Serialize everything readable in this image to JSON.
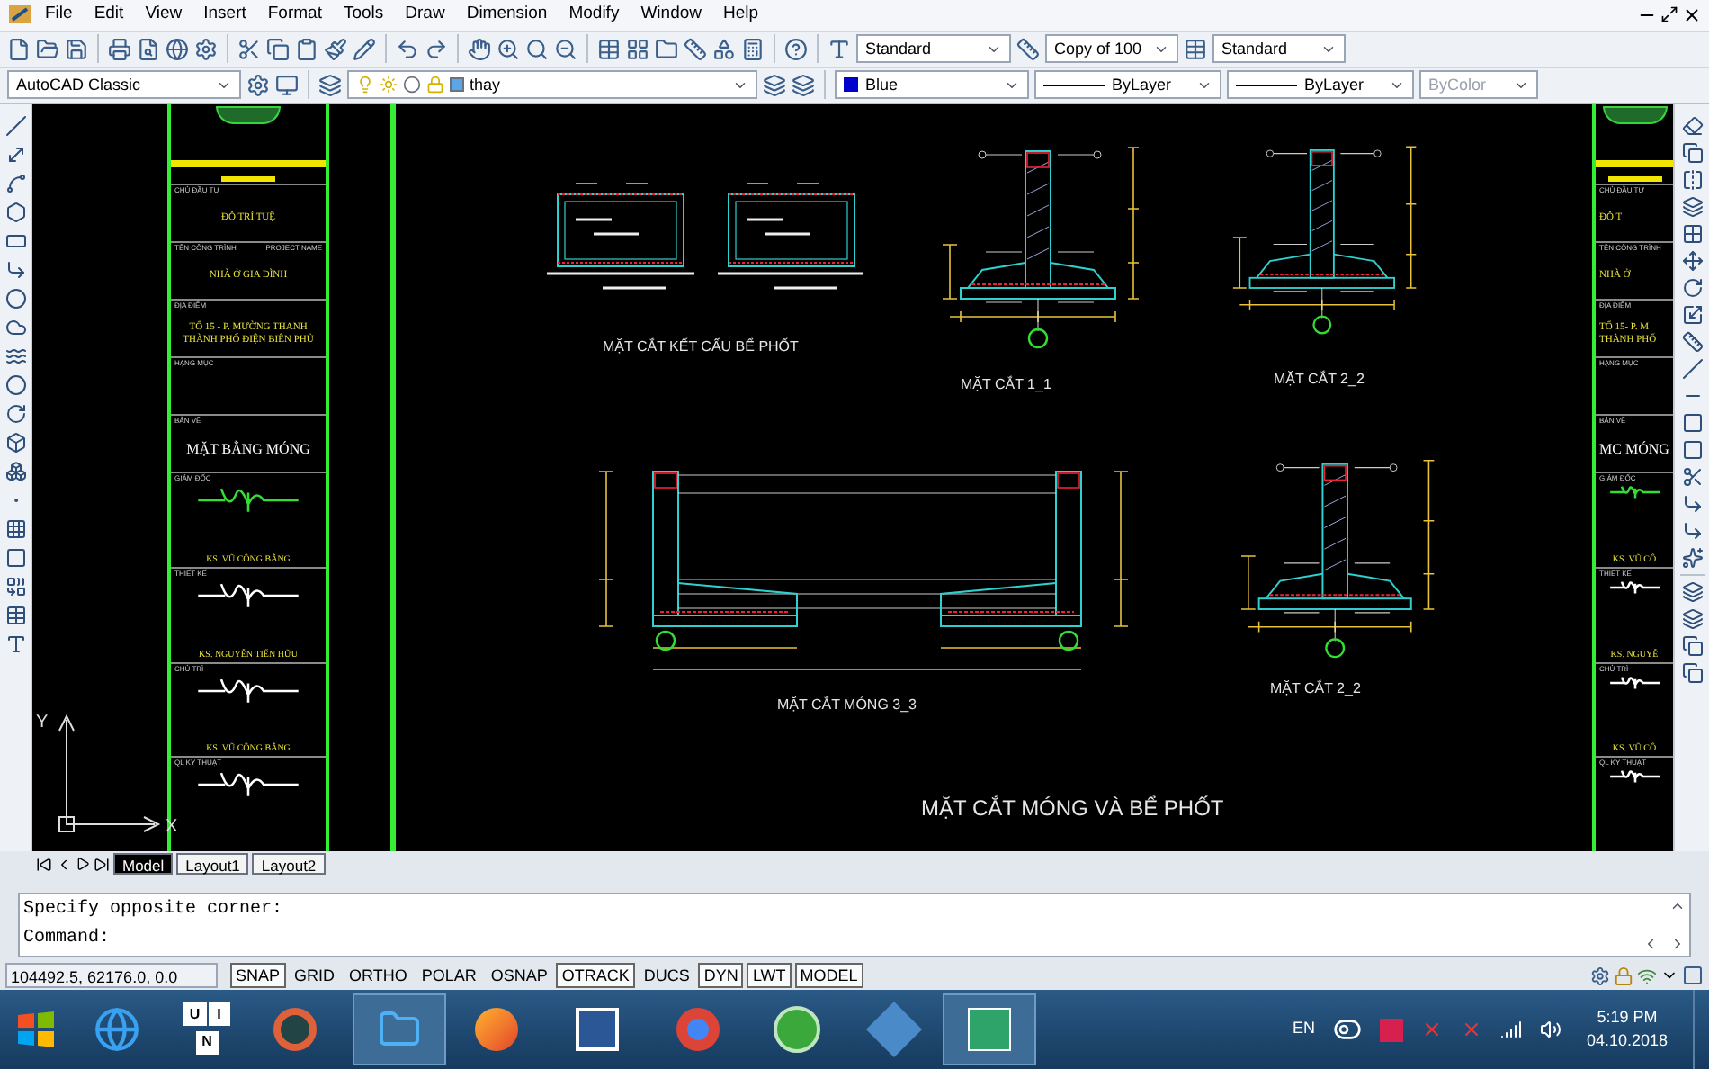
{
  "menu_bar": {
    "items": [
      "File",
      "Edit",
      "View",
      "Insert",
      "Format",
      "Tools",
      "Draw",
      "Dimension",
      "Modify",
      "Window",
      "Help"
    ]
  },
  "styles_toolbar": {
    "text_style": "Standard",
    "dim_style": "Copy of 100",
    "table_style": "Standard"
  },
  "workspace": "AutoCAD Classic",
  "layer": "thay",
  "properties_toolbar": {
    "color_setting": "Blue",
    "linetype": "ByLayer",
    "lineweight": "ByLayer",
    "plot_style": {
      "value": "ByColor",
      "disabled": true
    }
  },
  "title_block_left": {
    "rows": [
      {
        "kind": "text",
        "label": "CHỦ ĐẦU TƯ",
        "lines": [
          "ĐỖ TRÍ TUỆ"
        ]
      },
      {
        "kind": "text",
        "label": "TÊN CÔNG TRÌNH",
        "label_right": "PROJECT NAME",
        "lines": [
          "NHÀ Ở GIA ĐÌNH"
        ]
      },
      {
        "kind": "text",
        "label": "ĐỊA ĐIỂM",
        "lines": [
          "TỔ 15 - P. MƯỜNG THANH",
          "THÀNH PHỐ ĐIỆN BIÊN PHỦ"
        ]
      },
      {
        "kind": "text",
        "label": "HẠNG MỤC",
        "lines": []
      },
      {
        "kind": "title",
        "label": "BẢN VẼ",
        "lines": [
          "MẶT BẰNG MÓNG"
        ]
      },
      {
        "kind": "signature",
        "label": "GIÁM ĐỐC",
        "signer": "KS. VŨ CÔNG BẰNG",
        "color": "#33dd33"
      },
      {
        "kind": "signature",
        "label": "THIẾT KẾ",
        "signer": "KS. NGUYỄN TIẾN HỮU",
        "color": "#ffffff"
      },
      {
        "kind": "signature",
        "label": "CHỦ TRÌ",
        "signer": "KS. VŨ CÔNG BẰNG",
        "color": "#ffffff"
      },
      {
        "kind": "signature",
        "label": "QL KỸ THUẬT",
        "color": "#ffffff"
      }
    ]
  },
  "title_block_right": {
    "rows": [
      {
        "kind": "text",
        "label": "CHỦ ĐẦU TƯ",
        "lines": [
          "ĐỖ T"
        ]
      },
      {
        "kind": "text",
        "label": "TÊN CÔNG TRÌNH",
        "lines": [
          "NHÀ Ở"
        ]
      },
      {
        "kind": "text",
        "label": "ĐỊA ĐIỂM",
        "lines": [
          "TỔ 15- P. M",
          "THÀNH PHỐ"
        ]
      },
      {
        "kind": "text",
        "label": "HẠNG MỤC",
        "lines": []
      },
      {
        "kind": "title",
        "label": "BẢN VẼ",
        "lines": [
          "MC MÓNG"
        ]
      },
      {
        "kind": "signature",
        "label": "GIÁM ĐỐC",
        "signer": "KS. VŨ CÔ",
        "color": "#33dd33"
      },
      {
        "kind": "signature",
        "label": "THIẾT KẾ",
        "signer": "KS. NGUYỄ",
        "color": "#ffffff"
      },
      {
        "kind": "signature",
        "label": "CHỦ TRÌ",
        "signer": "KS. VŨ CÔ",
        "color": "#ffffff"
      },
      {
        "kind": "signature",
        "label": "QL KỸ THUẬT",
        "color": "#ffffff"
      }
    ]
  },
  "sections": [
    {
      "kind": "tank",
      "title": "MẶT CẮT KẾT CẤU BỂ PHỐT"
    },
    {
      "kind": "footing",
      "title": "MẶT CẮT 1_1"
    },
    {
      "kind": "footing",
      "title": "MẶT CẮT 2_2"
    },
    {
      "kind": "double_footing",
      "title": "MẶT CẮT MÓNG 3_3"
    },
    {
      "kind": "footing",
      "title": "MẶT CẮT 2_2"
    }
  ],
  "sheet_title": "MẶT CẮT MÓNG VÀ BỂ PHỐT",
  "ucs": {
    "x_label": "X",
    "y_label": "Y"
  },
  "layout_tabs": [
    {
      "label": "Model",
      "selected": true
    },
    {
      "label": "Layout1",
      "selected": false
    },
    {
      "label": "Layout2",
      "selected": false
    }
  ],
  "command_line": {
    "history": "Specify opposite corner:",
    "prompt": "Command:"
  },
  "status_bar": {
    "coordinates": "104492.5, 62176.0, 0.0",
    "toggles": [
      {
        "label": "SNAP",
        "on": true
      },
      {
        "label": "GRID",
        "on": false
      },
      {
        "label": "ORTHO",
        "on": false
      },
      {
        "label": "POLAR",
        "on": false
      },
      {
        "label": "OSNAP",
        "on": false
      },
      {
        "label": "OTRACK",
        "on": true
      },
      {
        "label": "DUCS",
        "on": false
      },
      {
        "label": "DYN",
        "on": true
      },
      {
        "label": "LWT",
        "on": true
      },
      {
        "label": "MODEL",
        "on": true
      }
    ]
  },
  "taskbar": {
    "keyboard_letters": [
      "U",
      "I",
      "N"
    ],
    "language": "EN",
    "time": "5:19 PM",
    "date": "04.10.2018"
  }
}
